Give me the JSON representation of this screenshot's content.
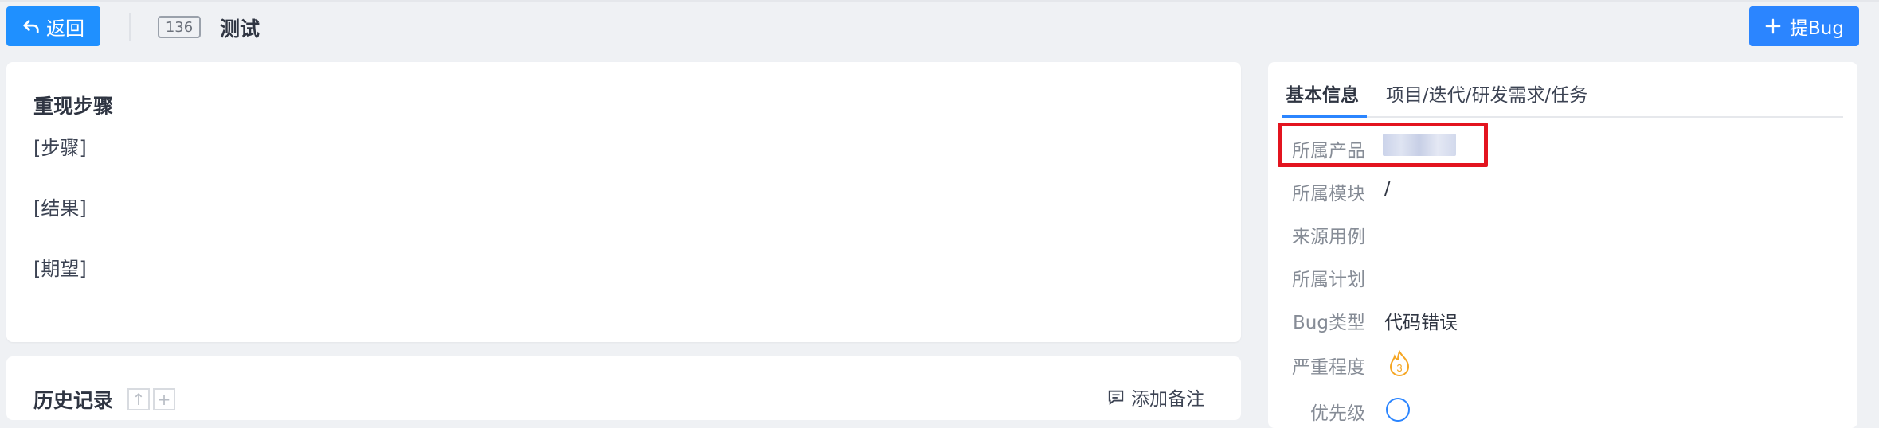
{
  "header": {
    "back_label": "返回",
    "bug_id": "136",
    "title": "测试",
    "add_bug_label": "提Bug"
  },
  "steps_card": {
    "title": "重现步骤",
    "lines": [
      "[步骤]",
      "[结果]",
      "[期望]"
    ]
  },
  "history_card": {
    "title": "历史记录",
    "add_note_label": "添加备注"
  },
  "side_panel": {
    "tabs": [
      "基本信息",
      "项目/迭代/研发需求/任务"
    ],
    "fields": [
      {
        "label": "所属产品",
        "value": ""
      },
      {
        "label": "所属模块",
        "value": "/"
      },
      {
        "label": "来源用例",
        "value": ""
      },
      {
        "label": "所属计划",
        "value": ""
      },
      {
        "label": "Bug类型",
        "value": "代码错误"
      },
      {
        "label": "严重程度",
        "value": "3"
      },
      {
        "label": "优先级",
        "value": ""
      }
    ]
  },
  "colors": {
    "primary": "#2b85ff",
    "back_button": "#1f90ff",
    "highlight": "#e3141f",
    "severity": "#f5a623"
  }
}
